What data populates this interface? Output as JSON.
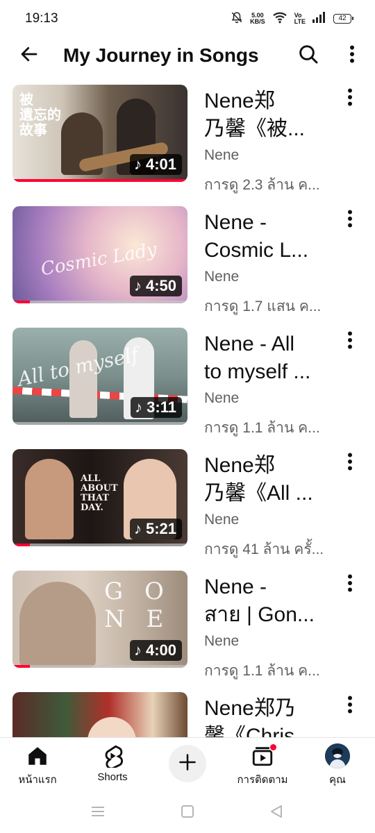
{
  "status_bar": {
    "time": "19:13",
    "network_speed_value": "5.00",
    "network_speed_unit": "KB/S",
    "volte_top": "Vo",
    "volte_bottom": "LTE",
    "battery_level": "42"
  },
  "header": {
    "title": "My Journey in Songs",
    "back_icon": "arrow-left-icon",
    "search_icon": "search-icon",
    "more_icon": "more-vert-icon"
  },
  "videos": [
    {
      "title_line1": "Nene郑",
      "title_line2": "乃馨《被...",
      "channel": "Nene",
      "views": "การดู 2.3 ล้าน ค...",
      "duration": "4:01",
      "thumbnail_caption": "被\n遺忘的\n故事",
      "watched_fraction": 1.0,
      "thumbnail_colors": [
        "#cfc6b8",
        "#6f5f4f",
        "#2d2a28"
      ]
    },
    {
      "title_line1": "Nene -",
      "title_line2": "Cosmic L...",
      "channel": "Nene",
      "views": "การดู 1.7 แสน ค...",
      "duration": "4:50",
      "thumbnail_caption": "Cosmic Lady",
      "watched_fraction": 0.1,
      "thumbnail_colors": [
        "#d9a6d8",
        "#f3d6c4",
        "#8a6aa8"
      ]
    },
    {
      "title_line1": "Nene - All",
      "title_line2": "to myself ...",
      "channel": "Nene",
      "views": "การดู 1.1 ล้าน ค...",
      "duration": "3:11",
      "thumbnail_caption": "All to myself",
      "watched_fraction": 0.0,
      "thumbnail_colors": [
        "#8fa3a0",
        "#5f7170",
        "#3b4444"
      ]
    },
    {
      "title_line1": "Nene郑",
      "title_line2": "乃馨《All ...",
      "channel": "Nene",
      "views": "การดู 41 ล้าน ครั้...",
      "duration": "5:21",
      "thumbnail_caption": "ALL ABOUT THAT DAY.",
      "watched_fraction": 0.1,
      "thumbnail_colors": [
        "#2b2220",
        "#1a1412",
        "#e9e2da"
      ]
    },
    {
      "title_line1": "Nene -",
      "title_line2": "สาย | Gon...",
      "channel": "Nene",
      "views": "การดู 1.1 ล้าน ค...",
      "duration": "4:00",
      "thumbnail_caption": "G O N E",
      "watched_fraction": 0.1,
      "thumbnail_colors": [
        "#d9cbbd",
        "#b8a593",
        "#8e7a69"
      ]
    },
    {
      "title_line1": "Nene郑乃",
      "title_line2": "馨《Chris...",
      "channel": "",
      "views": "",
      "duration": "",
      "thumbnail_caption": "",
      "watched_fraction": 0.0,
      "thumbnail_colors": [
        "#3f5a3a",
        "#b0302a",
        "#e8d3b8"
      ]
    }
  ],
  "bottom_nav": {
    "home_label": "หน้าแรก",
    "shorts_label": "Shorts",
    "subscriptions_label": "การติดตาม",
    "you_label": "คุณ",
    "home_icon": "home-icon",
    "shorts_icon": "shorts-icon",
    "create_icon": "plus-icon",
    "subscriptions_icon": "subscriptions-icon"
  },
  "system_nav": {
    "recents_icon": "menu-lines-icon",
    "home_icon": "square-icon",
    "back_icon": "triangle-back-icon"
  },
  "colors": {
    "accent_red": "#ff0033",
    "text_primary": "#0f0f0f",
    "text_secondary": "#606060"
  }
}
